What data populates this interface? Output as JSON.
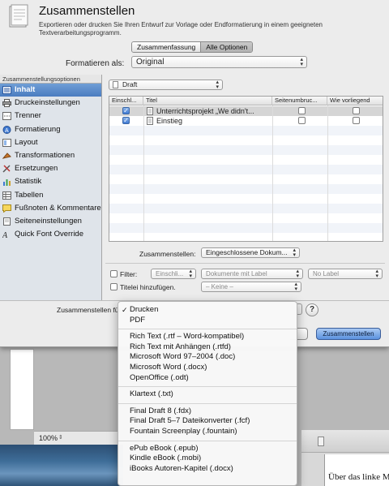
{
  "dialog": {
    "title": "Zusammenstellen",
    "subtitle": "Exportieren oder drucken Sie Ihren Entwurf zur Vorlage oder Endformatierung in einem geeigneten Textverarbeitungsprogramm.",
    "tabs": [
      "Zusammenfassung",
      "Alle Optionen"
    ],
    "active_tab": "Alle Optionen",
    "format_label": "Formatieren als:",
    "format_value": "Original"
  },
  "sidebar": {
    "header": "Zusammenstellungsoptionen",
    "items": [
      {
        "label": "Inhalt",
        "icon": "document-list-icon",
        "selected": true
      },
      {
        "label": "Druckeinstellungen",
        "icon": "printer-icon"
      },
      {
        "label": "Trenner",
        "icon": "separator-icon"
      },
      {
        "label": "Formatierung",
        "icon": "formatting-icon"
      },
      {
        "label": "Layout",
        "icon": "layout-icon"
      },
      {
        "label": "Transformationen",
        "icon": "transform-icon"
      },
      {
        "label": "Ersetzungen",
        "icon": "replacements-icon"
      },
      {
        "label": "Statistik",
        "icon": "statistics-icon"
      },
      {
        "label": "Tabellen",
        "icon": "table-icon"
      },
      {
        "label": "Fußnoten & Kommentare",
        "icon": "footnote-icon"
      },
      {
        "label": "Seiteneinstellungen",
        "icon": "page-setup-icon"
      },
      {
        "label": "Quick Font Override",
        "icon": "font-icon"
      }
    ]
  },
  "content": {
    "folder_popup": "Draft",
    "columns": [
      "Einschl...",
      "Titel",
      "Seitenumbruc...",
      "Wie vorliegend"
    ],
    "rows": [
      {
        "included": true,
        "title": "Unterrichtsprojekt „We didn't...",
        "page_break": false,
        "as_is": false
      },
      {
        "included": true,
        "title": "Einstieg",
        "page_break": false,
        "as_is": false
      }
    ],
    "compile_label": "Zusammenstellen:",
    "compile_value": "Eingeschlossene Dokum...",
    "filter_label": "Filter:",
    "filter_mode": "Einschli...",
    "filter_by": "Dokumente mit Label",
    "filter_value": "No Label",
    "title_prefix_label": "Titelei hinzufügen.",
    "title_prefix_value": "– Keine –"
  },
  "bottom": {
    "compile_for_label": "Zusammenstellen für:",
    "help": "?",
    "compile_button": "Zusammenstellen"
  },
  "menu": {
    "groups": [
      [
        {
          "label": "Drucken",
          "checked": true
        },
        {
          "label": "PDF"
        }
      ],
      [
        {
          "label": "Rich Text (.rtf – Word-kompatibel)"
        },
        {
          "label": "Rich Text mit Anhängen (.rtfd)"
        },
        {
          "label": "Microsoft Word 97–2004 (.doc)"
        },
        {
          "label": "Microsoft Word (.docx)"
        },
        {
          "label": "OpenOffice (.odt)"
        }
      ],
      [
        {
          "label": "Klartext (.txt)"
        }
      ],
      [
        {
          "label": "Final Draft 8 (.fdx)"
        },
        {
          "label": "Final Draft 5–7 Dateikonverter (.fcf)"
        },
        {
          "label": "Fountain Screenplay (.fountain)"
        }
      ],
      [
        {
          "label": "ePub eBook (.epub)"
        },
        {
          "label": "Kindle eBook (.mobi)"
        },
        {
          "label": "iBooks Autoren-Kapitel (.docx)"
        }
      ]
    ]
  },
  "background": {
    "zoom": "100%",
    "doc_text": "Über das linke M"
  }
}
